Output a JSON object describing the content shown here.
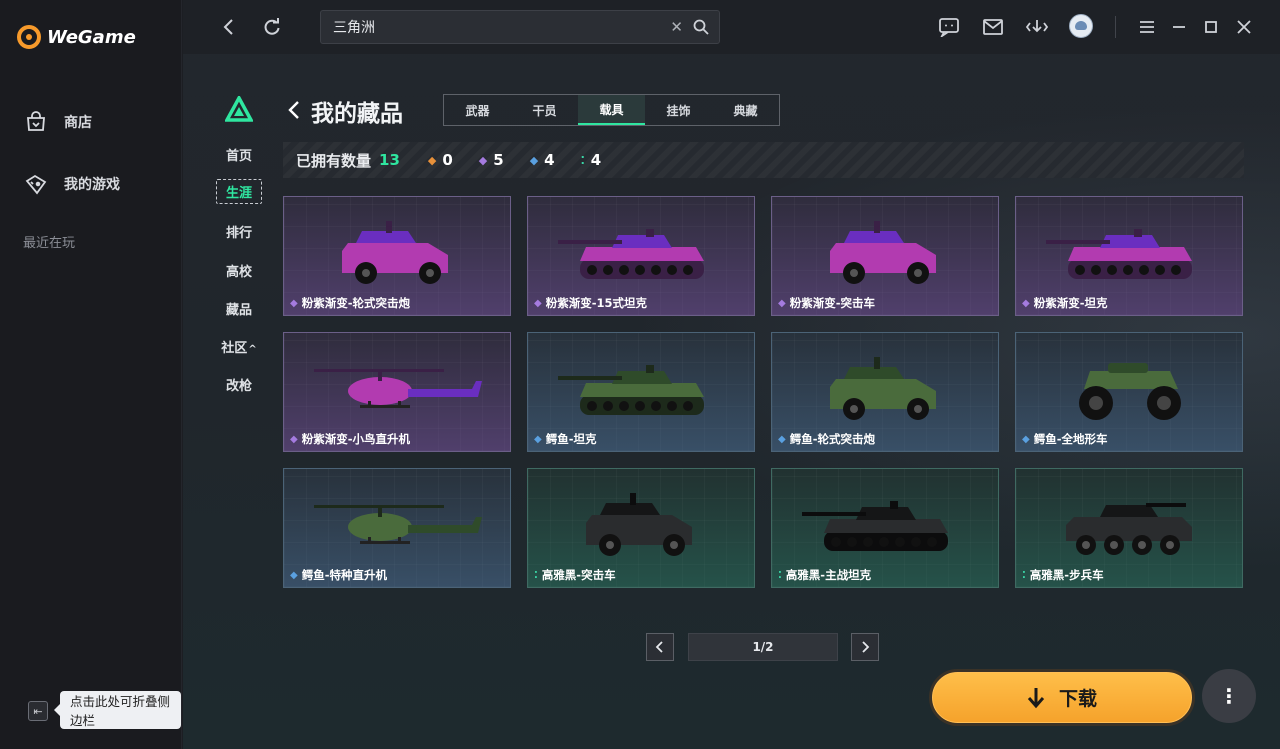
{
  "app": {
    "name": "WeGame"
  },
  "sidebar": {
    "items": [
      {
        "label": "商店",
        "icon": "bag-icon"
      },
      {
        "label": "我的游戏",
        "icon": "gamepad-icon"
      }
    ],
    "recent_label": "最近在玩",
    "collapse_tooltip": "点击此处可折叠侧边栏"
  },
  "search": {
    "value": "三角洲"
  },
  "game_nav": {
    "items": [
      "首页",
      "生涯",
      "排行",
      "高校",
      "藏品",
      "社区",
      "改枪"
    ],
    "active": "生涯",
    "community_caret": "^"
  },
  "page": {
    "title": "我的藏品",
    "tabs": [
      "武器",
      "干员",
      "载具",
      "挂饰",
      "典藏"
    ],
    "active_tab": "载具"
  },
  "counts": {
    "label": "已拥有数量",
    "total": "13",
    "rarities": [
      {
        "icon": "orange-diamond-icon",
        "color": "#e8913a",
        "value": "0"
      },
      {
        "icon": "purple-diamond-icon",
        "color": "#a57be0",
        "value": "5"
      },
      {
        "icon": "blue-diamond-icon",
        "color": "#5aa0e0",
        "value": "4"
      },
      {
        "icon": "green-dots-icon",
        "color": "#3ad6a6",
        "value": "4"
      }
    ]
  },
  "vehicles": [
    {
      "name": "粉紫渐变-轮式突击炮",
      "rarity": "purple",
      "kind": "apc"
    },
    {
      "name": "粉紫渐变-15式坦克",
      "rarity": "purple",
      "kind": "tank"
    },
    {
      "name": "粉紫渐变-突击车",
      "rarity": "purple",
      "kind": "apc"
    },
    {
      "name": "粉紫渐变-坦克",
      "rarity": "purple",
      "kind": "tank"
    },
    {
      "name": "粉紫渐变-小鸟直升机",
      "rarity": "purple",
      "kind": "heli"
    },
    {
      "name": "鳄鱼-坦克",
      "rarity": "blue",
      "kind": "tank"
    },
    {
      "name": "鳄鱼-轮式突击炮",
      "rarity": "blue",
      "kind": "apc"
    },
    {
      "name": "鳄鱼-全地形车",
      "rarity": "blue",
      "kind": "atv"
    },
    {
      "name": "鳄鱼-特种直升机",
      "rarity": "blue",
      "kind": "heli"
    },
    {
      "name": "高雅黑-突击车",
      "rarity": "green",
      "kind": "apc"
    },
    {
      "name": "高雅黑-主战坦克",
      "rarity": "green",
      "kind": "tank"
    },
    {
      "name": "高雅黑-步兵车",
      "rarity": "green",
      "kind": "ifv"
    }
  ],
  "pagination": {
    "text": "1/2"
  },
  "download": {
    "label": "下载"
  }
}
